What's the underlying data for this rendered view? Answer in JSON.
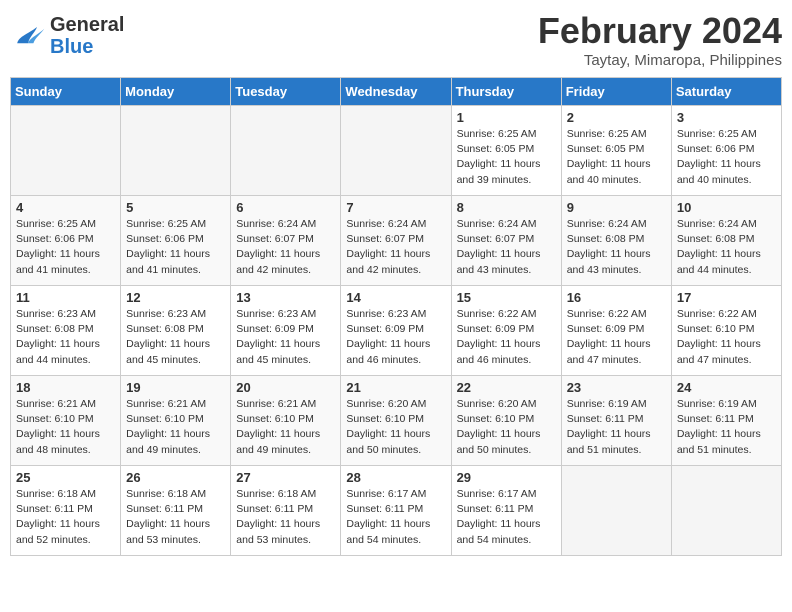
{
  "logo": {
    "line1": "General",
    "line2": "Blue"
  },
  "title": "February 2024",
  "subtitle": "Taytay, Mimaropa, Philippines",
  "days_of_week": [
    "Sunday",
    "Monday",
    "Tuesday",
    "Wednesday",
    "Thursday",
    "Friday",
    "Saturday"
  ],
  "weeks": [
    [
      {
        "day": "",
        "info": ""
      },
      {
        "day": "",
        "info": ""
      },
      {
        "day": "",
        "info": ""
      },
      {
        "day": "",
        "info": ""
      },
      {
        "day": "1",
        "info": "Sunrise: 6:25 AM\nSunset: 6:05 PM\nDaylight: 11 hours and 39 minutes."
      },
      {
        "day": "2",
        "info": "Sunrise: 6:25 AM\nSunset: 6:05 PM\nDaylight: 11 hours and 40 minutes."
      },
      {
        "day": "3",
        "info": "Sunrise: 6:25 AM\nSunset: 6:06 PM\nDaylight: 11 hours and 40 minutes."
      }
    ],
    [
      {
        "day": "4",
        "info": "Sunrise: 6:25 AM\nSunset: 6:06 PM\nDaylight: 11 hours and 41 minutes."
      },
      {
        "day": "5",
        "info": "Sunrise: 6:25 AM\nSunset: 6:06 PM\nDaylight: 11 hours and 41 minutes."
      },
      {
        "day": "6",
        "info": "Sunrise: 6:24 AM\nSunset: 6:07 PM\nDaylight: 11 hours and 42 minutes."
      },
      {
        "day": "7",
        "info": "Sunrise: 6:24 AM\nSunset: 6:07 PM\nDaylight: 11 hours and 42 minutes."
      },
      {
        "day": "8",
        "info": "Sunrise: 6:24 AM\nSunset: 6:07 PM\nDaylight: 11 hours and 43 minutes."
      },
      {
        "day": "9",
        "info": "Sunrise: 6:24 AM\nSunset: 6:08 PM\nDaylight: 11 hours and 43 minutes."
      },
      {
        "day": "10",
        "info": "Sunrise: 6:24 AM\nSunset: 6:08 PM\nDaylight: 11 hours and 44 minutes."
      }
    ],
    [
      {
        "day": "11",
        "info": "Sunrise: 6:23 AM\nSunset: 6:08 PM\nDaylight: 11 hours and 44 minutes."
      },
      {
        "day": "12",
        "info": "Sunrise: 6:23 AM\nSunset: 6:08 PM\nDaylight: 11 hours and 45 minutes."
      },
      {
        "day": "13",
        "info": "Sunrise: 6:23 AM\nSunset: 6:09 PM\nDaylight: 11 hours and 45 minutes."
      },
      {
        "day": "14",
        "info": "Sunrise: 6:23 AM\nSunset: 6:09 PM\nDaylight: 11 hours and 46 minutes."
      },
      {
        "day": "15",
        "info": "Sunrise: 6:22 AM\nSunset: 6:09 PM\nDaylight: 11 hours and 46 minutes."
      },
      {
        "day": "16",
        "info": "Sunrise: 6:22 AM\nSunset: 6:09 PM\nDaylight: 11 hours and 47 minutes."
      },
      {
        "day": "17",
        "info": "Sunrise: 6:22 AM\nSunset: 6:10 PM\nDaylight: 11 hours and 47 minutes."
      }
    ],
    [
      {
        "day": "18",
        "info": "Sunrise: 6:21 AM\nSunset: 6:10 PM\nDaylight: 11 hours and 48 minutes."
      },
      {
        "day": "19",
        "info": "Sunrise: 6:21 AM\nSunset: 6:10 PM\nDaylight: 11 hours and 49 minutes."
      },
      {
        "day": "20",
        "info": "Sunrise: 6:21 AM\nSunset: 6:10 PM\nDaylight: 11 hours and 49 minutes."
      },
      {
        "day": "21",
        "info": "Sunrise: 6:20 AM\nSunset: 6:10 PM\nDaylight: 11 hours and 50 minutes."
      },
      {
        "day": "22",
        "info": "Sunrise: 6:20 AM\nSunset: 6:10 PM\nDaylight: 11 hours and 50 minutes."
      },
      {
        "day": "23",
        "info": "Sunrise: 6:19 AM\nSunset: 6:11 PM\nDaylight: 11 hours and 51 minutes."
      },
      {
        "day": "24",
        "info": "Sunrise: 6:19 AM\nSunset: 6:11 PM\nDaylight: 11 hours and 51 minutes."
      }
    ],
    [
      {
        "day": "25",
        "info": "Sunrise: 6:18 AM\nSunset: 6:11 PM\nDaylight: 11 hours and 52 minutes."
      },
      {
        "day": "26",
        "info": "Sunrise: 6:18 AM\nSunset: 6:11 PM\nDaylight: 11 hours and 53 minutes."
      },
      {
        "day": "27",
        "info": "Sunrise: 6:18 AM\nSunset: 6:11 PM\nDaylight: 11 hours and 53 minutes."
      },
      {
        "day": "28",
        "info": "Sunrise: 6:17 AM\nSunset: 6:11 PM\nDaylight: 11 hours and 54 minutes."
      },
      {
        "day": "29",
        "info": "Sunrise: 6:17 AM\nSunset: 6:11 PM\nDaylight: 11 hours and 54 minutes."
      },
      {
        "day": "",
        "info": ""
      },
      {
        "day": "",
        "info": ""
      }
    ]
  ]
}
